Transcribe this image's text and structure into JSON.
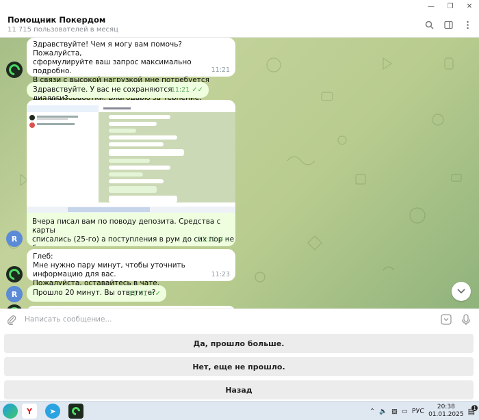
{
  "chat": {
    "title": "Помощник Покердом",
    "subtitle": "11 715 пользователей в месяц"
  },
  "messages": [
    {
      "lines": [
        "Здравствуйте! Чем я могу вам помочь? Пожалуйста,",
        "сформулируйте ваш запрос максимально подробно.",
        "В связи с высокой нагрузкой мне потребуется некоторое время",
        "для его обработки. Благодарю за терпение."
      ],
      "time": "11:21"
    },
    {
      "lines": [
        "Здравствуйте. У вас не сохраняются диалоги?"
      ],
      "time": "11:21"
    },
    {
      "lines": [
        "Вчера писал вам по поводу депозита. Средства с карты",
        "списались (25-го) а поступления в рум до сих пор не было"
      ],
      "time": "11:22"
    },
    {
      "lines": [
        "Глеб:",
        "Мне нужно пару минут, чтобы уточнить информацию для вас.",
        "Пожалуйста, оставайтесь в чате."
      ],
      "time": "11:23"
    },
    {
      "lines": [
        "Прошло 20 минут. Вы ответите?"
      ],
      "time": "11:41"
    }
  ],
  "avatars": {
    "user_letter": "R"
  },
  "composer": {
    "placeholder": "Написать сообщение..."
  },
  "keyboard": {
    "buttons": [
      "Да, прошло больше.",
      "Нет, еще не прошло.",
      "Назад"
    ]
  },
  "taskbar": {
    "language": "РУС",
    "time": "20:38",
    "date": "01.01.2025",
    "notifications": "1"
  },
  "colors": {
    "incoming": "#ffffff",
    "outgoing": "#eefedf",
    "check": "#4fae4e",
    "chat_bg": "#b9cc8f"
  }
}
